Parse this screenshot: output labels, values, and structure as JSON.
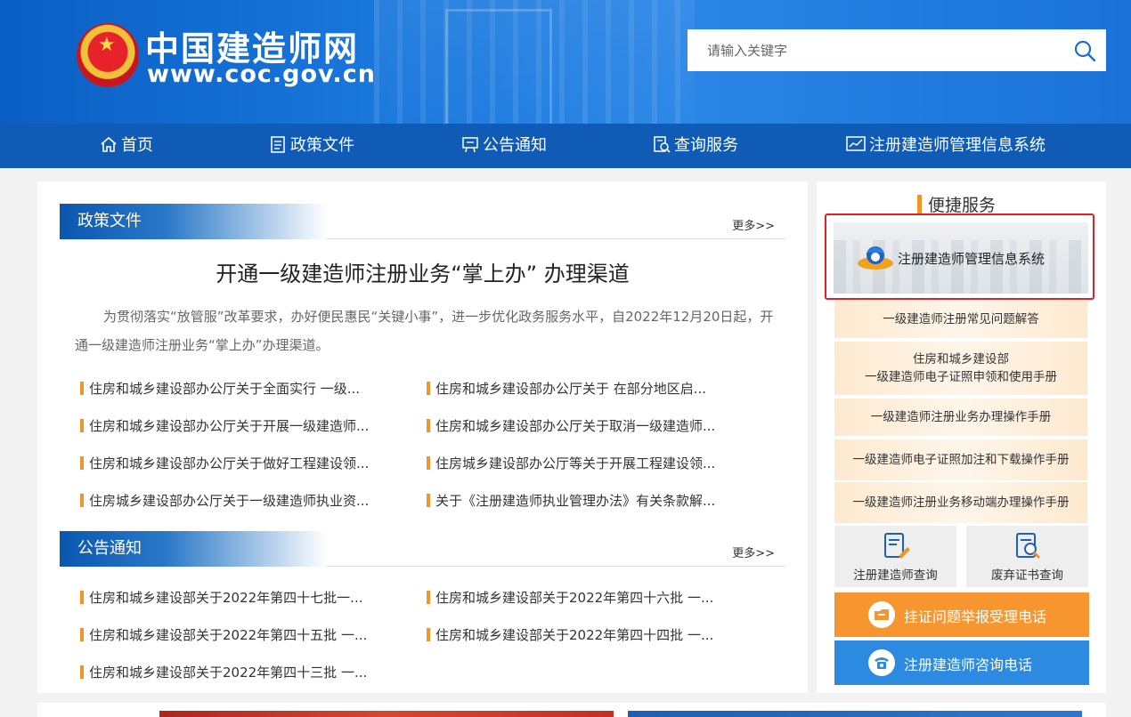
{
  "header": {
    "logo_cn": "中国建造师网",
    "logo_en": "www.coc.gov.cn",
    "search_placeholder": "请输入关键字"
  },
  "nav": [
    {
      "label": "首页",
      "icon": "home-icon"
    },
    {
      "label": "政策文件",
      "icon": "document-icon"
    },
    {
      "label": "公告通知",
      "icon": "notice-board-icon"
    },
    {
      "label": "查询服务",
      "icon": "search-document-icon"
    },
    {
      "label": "注册建造师管理信息系统",
      "icon": "chart-icon"
    }
  ],
  "policy": {
    "title": "政策文件",
    "more": "更多>>",
    "headline": "开通一级建造师注册业务“掌上办” 办理渠道",
    "summary": "为贯彻落实“放管服”改革要求，办好便民惠民“关键小事”，进一步优化政务服务水平，自2022年12月20日起，开通一级建造师注册业务“掌上办”办理渠道。",
    "items": [
      "住房和城乡建设部办公厅关于全面实行 一级...",
      "住房和城乡建设部办公厅关于 在部分地区启...",
      "住房和城乡建设部办公厅关于开展一级建造师...",
      "住房和城乡建设部办公厅关于取消一级建造师...",
      "住房和城乡建设部办公厅关于做好工程建设领...",
      "住房城乡建设部办公厅等关于开展工程建设领...",
      "住房城乡建设部办公厅关于一级建造师执业资...",
      "关于《注册建造师执业管理办法》有关条款解..."
    ]
  },
  "notice": {
    "title": "公告通知",
    "more": "更多>>",
    "items": [
      "住房和城乡建设部关于2022年第四十七批一...",
      "住房和城乡建设部关于2022年第四十六批 一...",
      "住房和城乡建设部关于2022年第四十五批 一...",
      "住房和城乡建设部关于2022年第四十四批 一...",
      "住房和城乡建设部关于2022年第四十三批 一..."
    ]
  },
  "services": {
    "title": "便捷服务",
    "system": "注册建造师管理信息系统",
    "links": [
      {
        "line1": "一级建造师注册常见问题解答",
        "line2": ""
      },
      {
        "line1": "住房和城乡建设部",
        "line2": "一级建造师电子证照申领和使用手册"
      },
      {
        "line1": "一级建造师注册业务办理操作手册",
        "line2": ""
      },
      {
        "line1": "一级建造师电子证照加注和下载操作手册",
        "line2": ""
      },
      {
        "line1": "一级建造师注册业务移动端办理操作手册",
        "line2": ""
      }
    ],
    "tiles": [
      {
        "label": "注册建造师查询",
        "icon": "registry-search-icon"
      },
      {
        "label": "废弃证书查询",
        "icon": "certificate-search-icon"
      }
    ],
    "report_hotline": "挂证问题举报受理电话",
    "consult_hotline": "注册建造师咨询电话"
  },
  "colors": {
    "nav_bg": "#0f5bb5",
    "accent_orange": "#f29428",
    "report_bar": "#f7962f",
    "consult_bar": "#2c8be0",
    "highlight_frame": "#e31e24"
  }
}
